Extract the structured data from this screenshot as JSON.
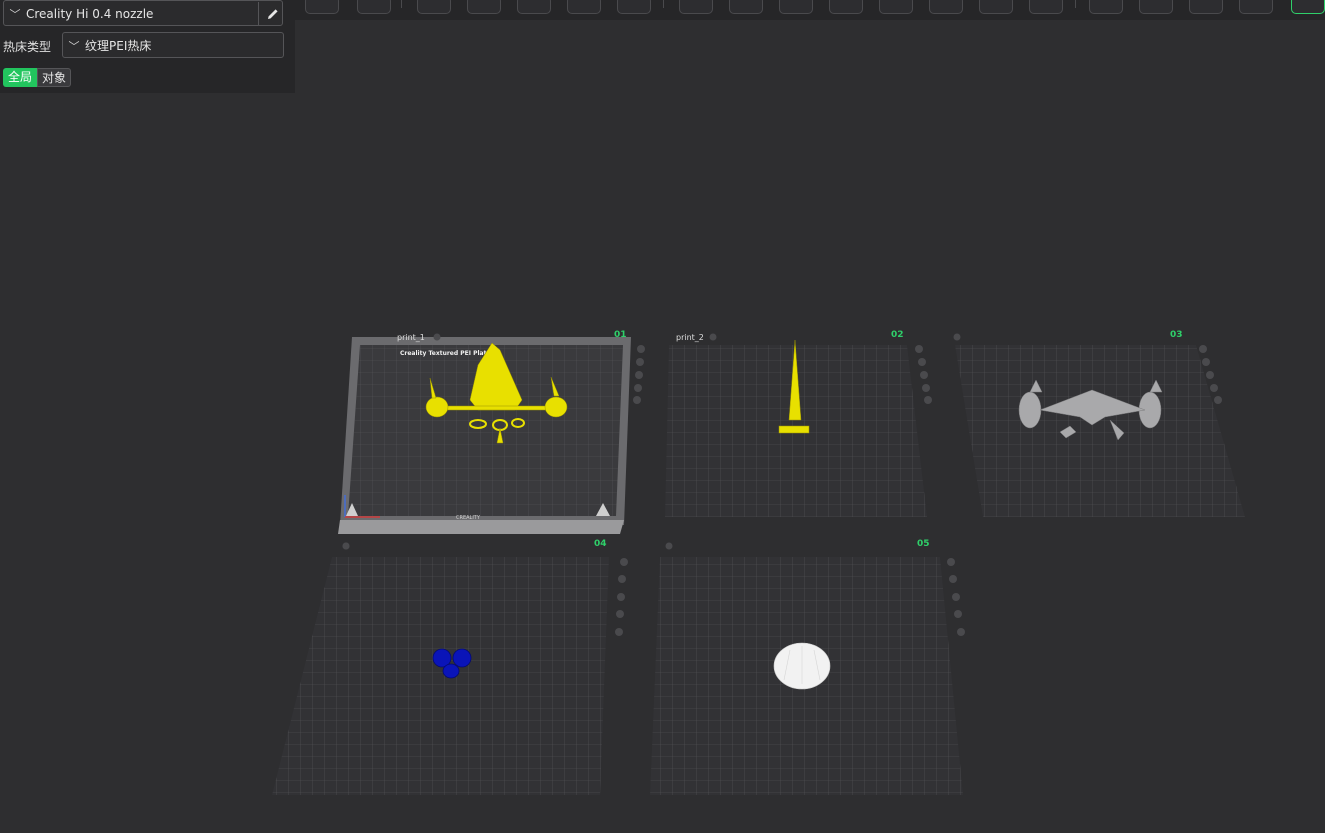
{
  "settings_panel": {
    "printer_preset": "Creality Hi 0.4 nozzle",
    "bed_type_label": "热床类型",
    "bed_type_value": "纹理PEI热床",
    "scope_global": "全局",
    "scope_object": "对象"
  },
  "toolbar": {
    "icons": [
      "add-object-icon",
      "keyboard-icon",
      "orient-icon",
      "arrange-icon",
      "auto-arrange-icon",
      "layout-icon",
      "split-icon",
      "grid-icon",
      "move-icon",
      "scale-icon",
      "rotate-icon",
      "cut-icon",
      "support-paint-icon",
      "seam-paint-icon",
      "measure-icon",
      "emboss-icon",
      "text-icon",
      "plate-icon",
      "view-icon",
      "slice-icon",
      "more-icon"
    ]
  },
  "plates": [
    {
      "label": "print_1",
      "number": "01",
      "model_color": "#e8e000",
      "bed_brand": "Creality Textured PEI Plate",
      "bed_logo": "CREALITY"
    },
    {
      "label": "print_2",
      "number": "02",
      "model_color": "#e8e000"
    },
    {
      "label": "",
      "number": "03",
      "model_color": "#a9a9ab"
    },
    {
      "label": "",
      "number": "04",
      "model_color": "#0a14b8"
    },
    {
      "label": "",
      "number": "05",
      "model_color": "#f2f2f2"
    }
  ],
  "colors": {
    "accent": "#22c55e",
    "panel_bg": "#262628",
    "viewport_bg": "#2e2e30",
    "grid": "#5a5a5d"
  }
}
